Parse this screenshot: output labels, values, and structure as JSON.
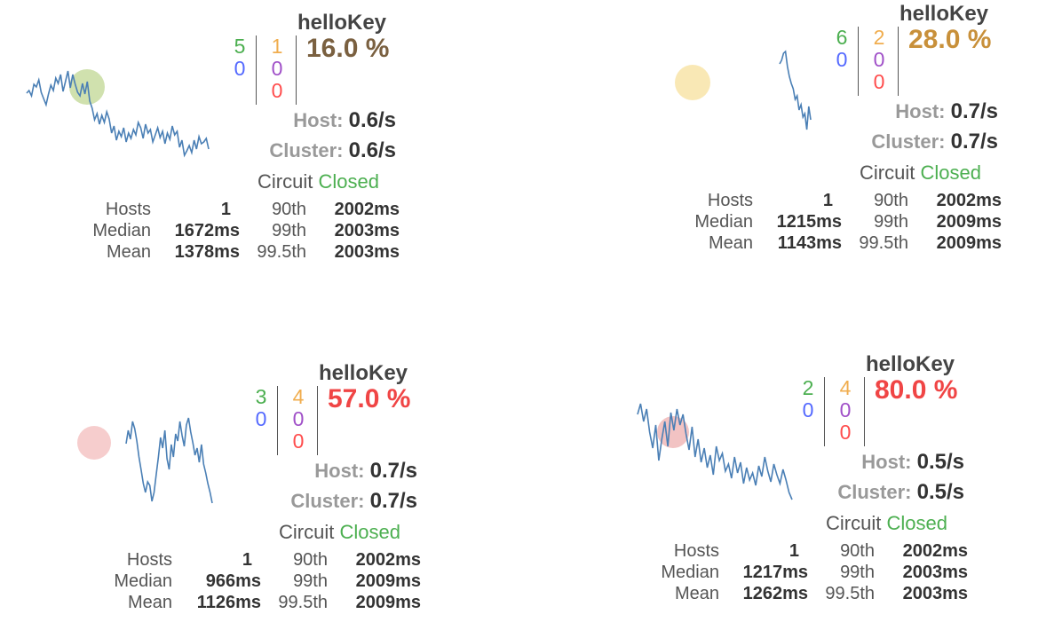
{
  "circuits": [
    {
      "title": "helloKey",
      "success": "5",
      "short_circuited": "0",
      "timeout": "1",
      "rejected": "0",
      "failure": "0",
      "error_pct": "16.0 %",
      "error_color": "#7a6040",
      "circle_color": "#c8dca0",
      "host_label": "Host:",
      "host_rate": "0.6/s",
      "cluster_label": "Cluster:",
      "cluster_rate": "0.6/s",
      "circuit_label": "Circuit",
      "circuit_state": "Closed",
      "hosts_label": "Hosts",
      "hosts": "1",
      "median_label": "Median",
      "median": "1672ms",
      "mean_label": "Mean",
      "mean": "1378ms",
      "p90_label": "90th",
      "p90": "2002ms",
      "p99_label": "99th",
      "p99": "2003ms",
      "p995_label": "99.5th",
      "p995": "2003ms",
      "sparkline": [
        95,
        92,
        98,
        85,
        88,
        80,
        94,
        101,
        108,
        96,
        86,
        92,
        78,
        84,
        74,
        93,
        82,
        70,
        89,
        74,
        85,
        94,
        98,
        84,
        96,
        82,
        104,
        112,
        125,
        118,
        130,
        120,
        128,
        116,
        124,
        140,
        132,
        148,
        138,
        144,
        134,
        150,
        140,
        146,
        136,
        142,
        128,
        134,
        146,
        130,
        140,
        136,
        150,
        142,
        134,
        145,
        138,
        152,
        140,
        147,
        132,
        142,
        138,
        156,
        148,
        165,
        160,
        154,
        162,
        148,
        158,
        144,
        152,
        150,
        146,
        158
      ]
    },
    {
      "title": "helloKey",
      "success": "6",
      "short_circuited": "0",
      "timeout": "2",
      "rejected": "0",
      "failure": "0",
      "error_pct": "28.0 %",
      "error_color": "#c8903a",
      "circle_color": "#f8e4a8",
      "host_label": "Host:",
      "host_rate": "0.7/s",
      "cluster_label": "Cluster:",
      "cluster_rate": "0.7/s",
      "circuit_label": "Circuit",
      "circuit_state": "Closed",
      "hosts_label": "Hosts",
      "hosts": "1",
      "median_label": "Median",
      "median": "1215ms",
      "mean_label": "Mean",
      "mean": "1143ms",
      "p90_label": "90th",
      "p90": "2002ms",
      "p99_label": "99th",
      "p99": "2009ms",
      "p995_label": "99.5th",
      "p995": "2009ms",
      "sparkline": [
        72,
        68,
        60,
        58,
        75,
        86,
        94,
        100,
        112,
        108,
        124,
        118,
        132,
        128,
        146,
        120,
        135
      ]
    },
    {
      "title": "helloKey",
      "success": "3",
      "short_circuited": "0",
      "timeout": "4",
      "rejected": "0",
      "failure": "0",
      "error_pct": "57.0 %",
      "error_color": "#f04545",
      "circle_color": "#f5c4c4",
      "host_label": "Host:",
      "host_rate": "0.7/s",
      "cluster_label": "Cluster:",
      "cluster_rate": "0.7/s",
      "circuit_label": "Circuit",
      "circuit_state": "Closed",
      "hosts_label": "Hosts",
      "hosts": "1",
      "median_label": "Median",
      "median": "966ms",
      "mean_label": "Mean",
      "mean": "1126ms",
      "p90_label": "90th",
      "p90": "2002ms",
      "p99_label": "99th",
      "p99": "2009ms",
      "p995_label": "99.5th",
      "p995": "2009ms",
      "sparkline": [
        95,
        80,
        90,
        70,
        78,
        92,
        110,
        125,
        140,
        150,
        138,
        142,
        160,
        150,
        130,
        110,
        88,
        100,
        80,
        112,
        124,
        96,
        110,
        84,
        92,
        70,
        86,
        98,
        74,
        66,
        82,
        94,
        108,
        100,
        116,
        96,
        118,
        128,
        140,
        150,
        162
      ]
    },
    {
      "title": "helloKey",
      "success": "2",
      "short_circuited": "0",
      "timeout": "4",
      "rejected": "0",
      "failure": "0",
      "error_pct": "80.0 %",
      "error_color": "#f04545",
      "circle_color": "#f0b8b8",
      "host_label": "Host:",
      "host_rate": "0.5/s",
      "cluster_label": "Cluster:",
      "cluster_rate": "0.5/s",
      "circuit_label": "Circuit",
      "circuit_state": "Closed",
      "hosts_label": "Hosts",
      "hosts": "1",
      "median_label": "Median",
      "median": "1217ms",
      "mean_label": "Mean",
      "mean": "1262ms",
      "p90_label": "90th",
      "p90": "2002ms",
      "p99_label": "99th",
      "p99": "2003ms",
      "p995_label": "99.5th",
      "p995": "2003ms",
      "sparkline": [
        72,
        60,
        80,
        66,
        92,
        110,
        84,
        124,
        100,
        80,
        108,
        70,
        90,
        66,
        84,
        72,
        94,
        112,
        86,
        120,
        100,
        126,
        110,
        132,
        118,
        140,
        108,
        124,
        116,
        136,
        128,
        144,
        120,
        138,
        126,
        150,
        132,
        146,
        138,
        152,
        130,
        142,
        120,
        136,
        148,
        128,
        140,
        150,
        134,
        146,
        160,
        168
      ]
    }
  ]
}
